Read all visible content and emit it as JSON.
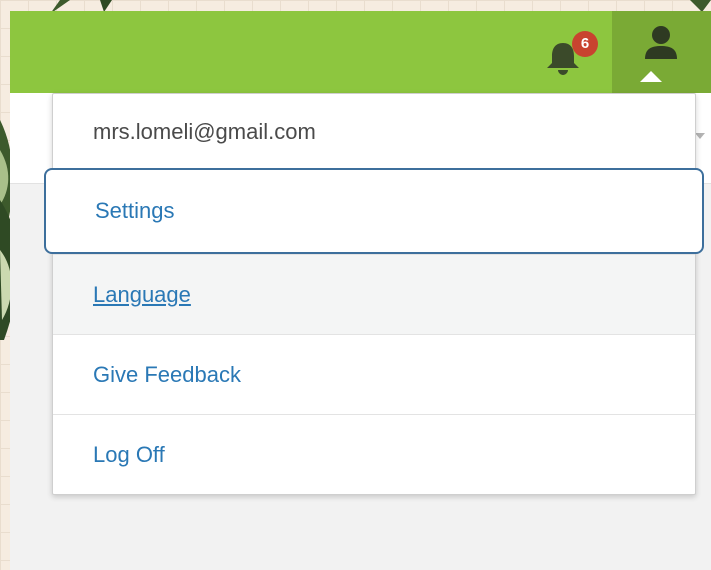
{
  "header": {
    "notification_count": "6",
    "icons": {
      "bell": "bell-icon",
      "user": "user-icon"
    }
  },
  "user_menu": {
    "email": "mrs.lomeli@gmail.com",
    "items": [
      {
        "label": "Settings",
        "state": "focused"
      },
      {
        "label": "Language",
        "state": "hovered"
      },
      {
        "label": "Give Feedback",
        "state": "normal"
      },
      {
        "label": "Log Off",
        "state": "normal"
      }
    ]
  },
  "colors": {
    "topbar": "#8dc63f",
    "user_button": "#7aaa35",
    "badge": "#c8432f",
    "link": "#2a78b5",
    "focus_outline": "#3d6f9c"
  }
}
